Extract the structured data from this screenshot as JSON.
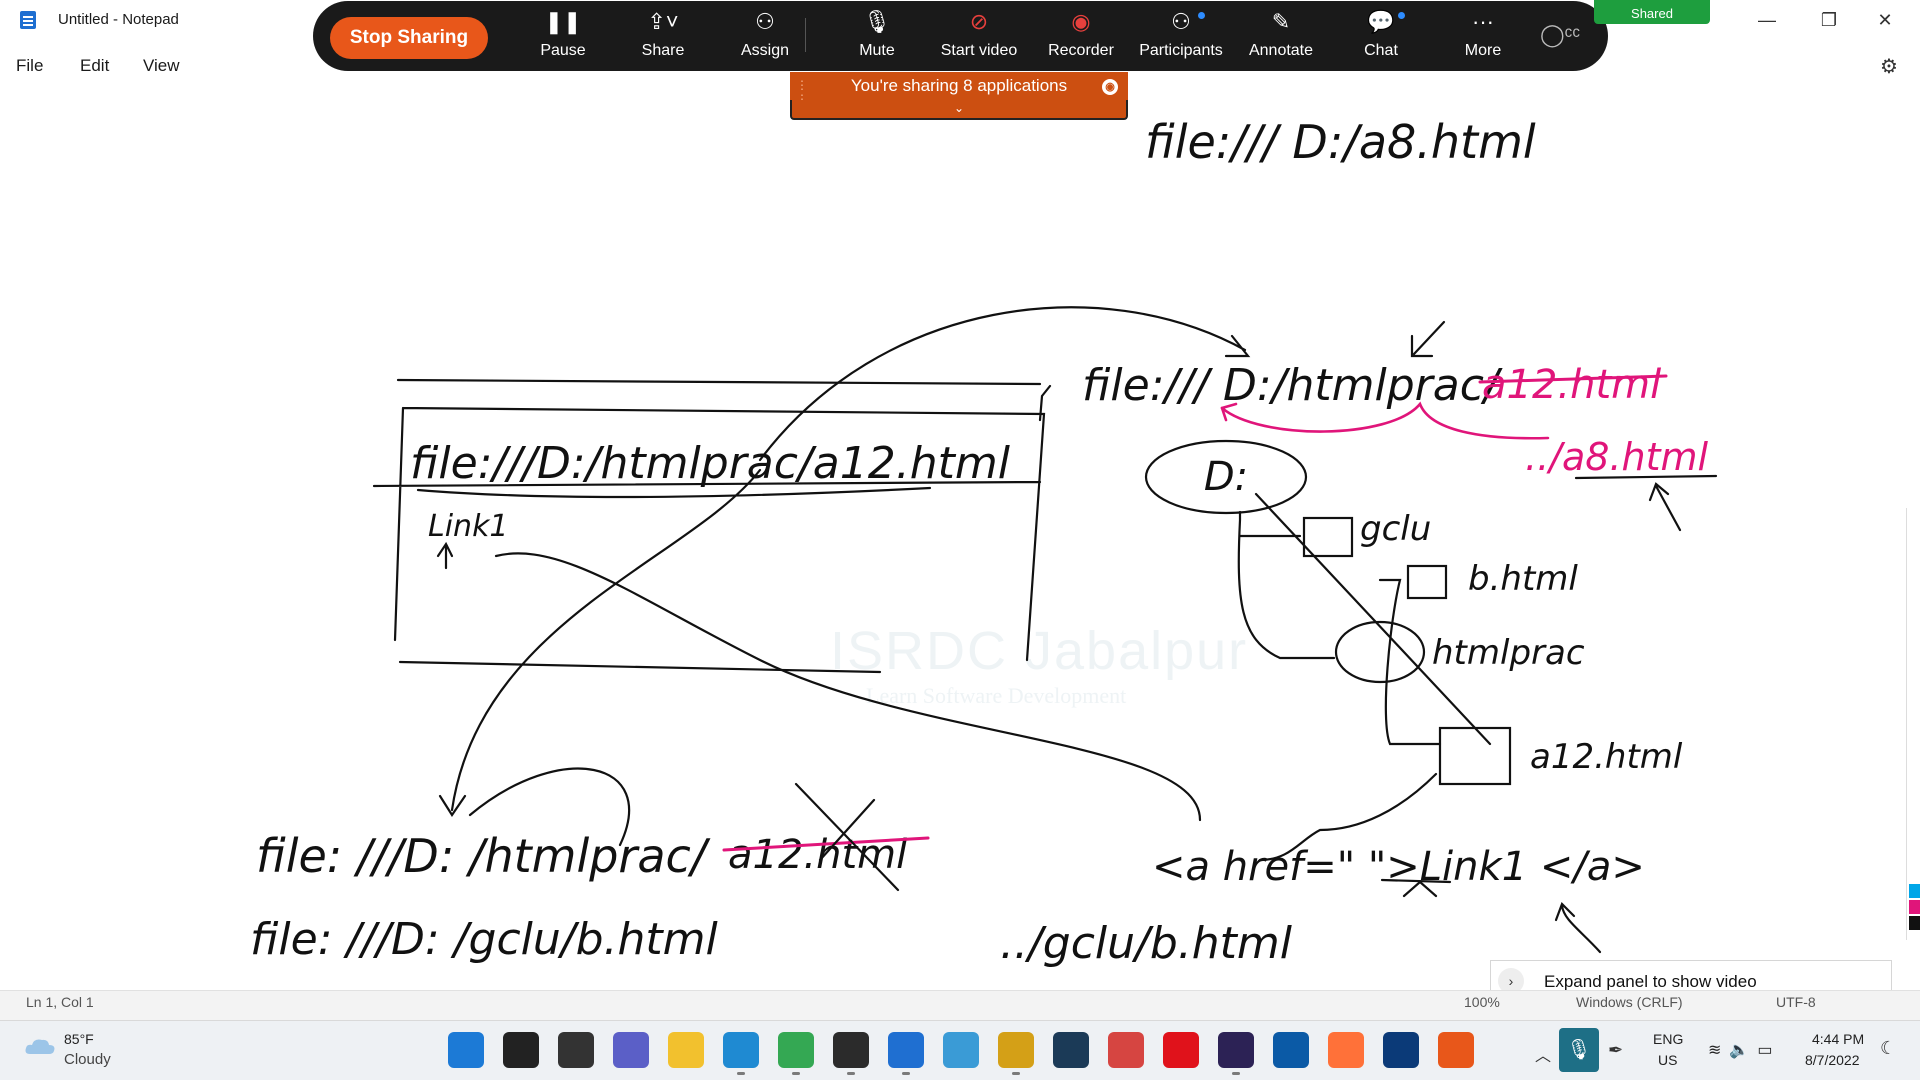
{
  "window": {
    "title": "Untitled - Notepad",
    "controls": {
      "minimize": "—",
      "restore": "❐",
      "close": "✕"
    }
  },
  "menu": {
    "file": "File",
    "edit": "Edit",
    "view": "View"
  },
  "zoom": {
    "stop_sharing": "Stop Sharing",
    "tools": [
      {
        "label": "Pause",
        "icon": "pause-icon",
        "glyph": "❚❚"
      },
      {
        "label": "Share",
        "icon": "share-screen-icon",
        "glyph": "⇪˅"
      },
      {
        "label": "Assign",
        "icon": "assign-icon",
        "glyph": "⚇"
      },
      {
        "label": "Mute",
        "icon": "microphone-icon",
        "glyph": "🎙"
      },
      {
        "label": "Start video",
        "icon": "video-off-icon",
        "glyph": "⊘"
      },
      {
        "label": "Recorder",
        "icon": "record-icon",
        "glyph": "◉"
      },
      {
        "label": "Participants",
        "icon": "participants-icon",
        "glyph": "⚇"
      },
      {
        "label": "Annotate",
        "icon": "annotate-icon",
        "glyph": "✎"
      },
      {
        "label": "Chat",
        "icon": "chat-icon",
        "glyph": "💬"
      },
      {
        "label": "More",
        "icon": "more-icon",
        "glyph": "···"
      }
    ],
    "shared_badge": "Shared",
    "sharing_banner": "You're sharing 8 applications",
    "brand_color": "#e8571a",
    "banner_color": "#cc4f11"
  },
  "ink": {
    "url_top": "file:/// D:/a8.html",
    "url_in_box": "file:///D:/htmlprac/a12.html",
    "box_link": "Link1",
    "url_right": "file:/// D:/htmlprac/",
    "url_right_struck": "a12.html",
    "relative_pink": "../a8.html",
    "drive": "D:",
    "folder_gclu": "gclu",
    "file_b": "b.html",
    "folder_htmlprac": "htmlprac",
    "file_a12": "a12.html",
    "url_bottom_1": "file: ///D: /htmlprac/",
    "url_bottom_1_struck": "a12.html",
    "url_bottom_2": "file: ///D: /gclu/b.html",
    "anchor_code": "<a href=\"  \">Link1 </a>",
    "relative_bottom": "../gclu/b.html",
    "ink_color": "#111111",
    "pink_color": "#e0157a"
  },
  "watermark": {
    "title": "ISRDC Jabalpur",
    "subtitle": "Learn Software Development"
  },
  "expand_panel": {
    "label": "Expand panel to show video"
  },
  "status": {
    "position": "Ln 1, Col 1",
    "zoom": "100%",
    "line_ending": "Windows (CRLF)",
    "encoding": "UTF-8"
  },
  "taskbar": {
    "weather_temp": "85°F",
    "weather_cond": "Cloudy",
    "lang_1": "ENG",
    "lang_2": "US",
    "time": "4:44 PM",
    "date": "8/7/2022",
    "apps": [
      {
        "name": "start-icon",
        "color": "#1c7ad6"
      },
      {
        "name": "search-icon",
        "color": "#222222"
      },
      {
        "name": "task-view-icon",
        "color": "#333333"
      },
      {
        "name": "teams-chat-icon",
        "color": "#5b5fc7"
      },
      {
        "name": "file-explorer-icon",
        "color": "#f2c12e"
      },
      {
        "name": "vscode-icon",
        "color": "#1f8ad2"
      },
      {
        "name": "chrome-icon",
        "color": "#34a853"
      },
      {
        "name": "terminal-icon",
        "color": "#2b2b2b"
      },
      {
        "name": "notepad-icon",
        "color": "#1f6fd1"
      },
      {
        "name": "maps-icon",
        "color": "#3a9bd6"
      },
      {
        "name": "paint-icon",
        "color": "#d4a017"
      },
      {
        "name": "mysql-icon",
        "color": "#1b3a57"
      },
      {
        "name": "eraser-icon",
        "color": "#d64541"
      },
      {
        "name": "opera-icon",
        "color": "#e0121b"
      },
      {
        "name": "eclipse-icon",
        "color": "#2c2255"
      },
      {
        "name": "feather-icon",
        "color": "#0b5aa6"
      },
      {
        "name": "firefox-icon",
        "color": "#ff7139"
      },
      {
        "name": "webex-icon",
        "color": "#0b3a78"
      },
      {
        "name": "zoom-icon",
        "color": "#e8571a"
      }
    ]
  }
}
